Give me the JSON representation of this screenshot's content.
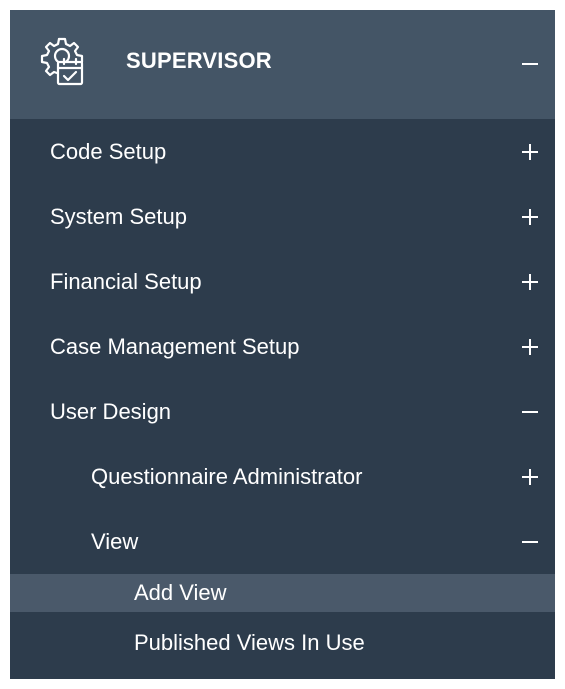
{
  "menu": {
    "header": {
      "title": "SUPERVISOR",
      "icon": "gear-calendar-icon",
      "state": "expanded"
    },
    "items": [
      {
        "label": "Code Setup",
        "level": 1,
        "toggle": "plus"
      },
      {
        "label": "System Setup",
        "level": 1,
        "toggle": "plus"
      },
      {
        "label": "Financial Setup",
        "level": 1,
        "toggle": "plus"
      },
      {
        "label": "Case Management Setup",
        "level": 1,
        "toggle": "plus"
      },
      {
        "label": "User Design",
        "level": 1,
        "toggle": "minus"
      },
      {
        "label": "Questionnaire Administrator",
        "level": 2,
        "toggle": "plus"
      },
      {
        "label": "View",
        "level": 2,
        "toggle": "minus"
      },
      {
        "label": "Add View",
        "level": 3,
        "active": true
      },
      {
        "label": "Published Views In Use",
        "level": 3
      }
    ]
  },
  "colors": {
    "panel_bg": "#2d3c4c",
    "header_bg": "#445566",
    "active_bg": "#4a596a",
    "text": "#ffffff"
  }
}
